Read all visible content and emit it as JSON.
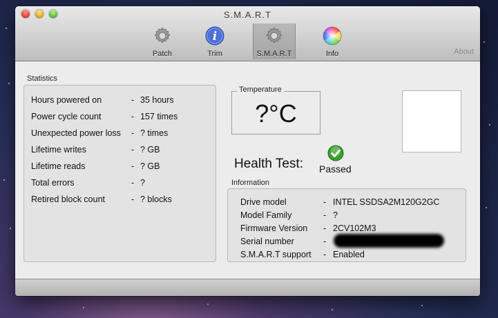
{
  "window": {
    "title": "S.M.A.R.T"
  },
  "toolbar": {
    "items": [
      {
        "label": "Patch",
        "icon": "gear-icon"
      },
      {
        "label": "Trim",
        "icon": "info-i-icon"
      },
      {
        "label": "S.M.A.R.T",
        "icon": "gear-icon",
        "selected": true
      },
      {
        "label": "Info",
        "icon": "color-wheel-icon"
      }
    ],
    "about_label": "About"
  },
  "statistics": {
    "title": "Statistics",
    "rows": [
      {
        "label": "Hours powered on",
        "value": "35 hours"
      },
      {
        "label": "Power cycle count",
        "value": "157 times"
      },
      {
        "label": "Unexpected power loss",
        "value": "? times"
      },
      {
        "label": "Lifetime writes",
        "value": "? GB"
      },
      {
        "label": "Lifetime reads",
        "value": "? GB"
      },
      {
        "label": "Total errors",
        "value": "?"
      },
      {
        "label": "Retired block count",
        "value": "? blocks"
      }
    ]
  },
  "temperature": {
    "title": "Temperature",
    "value": "?°C"
  },
  "health": {
    "label": "Health Test:",
    "status": "Passed",
    "status_color": "#3aa02c"
  },
  "information": {
    "title": "Information",
    "rows": [
      {
        "label": "Drive model",
        "value": "INTEL SSDSA2M120G2GC"
      },
      {
        "label": "Model Family",
        "value": "?"
      },
      {
        "label": "Firmware Version",
        "value": "2CV102M3"
      },
      {
        "label": "Serial number",
        "value": ""
      },
      {
        "label": "S.M.A.R.T support",
        "value": "Enabled"
      }
    ]
  }
}
